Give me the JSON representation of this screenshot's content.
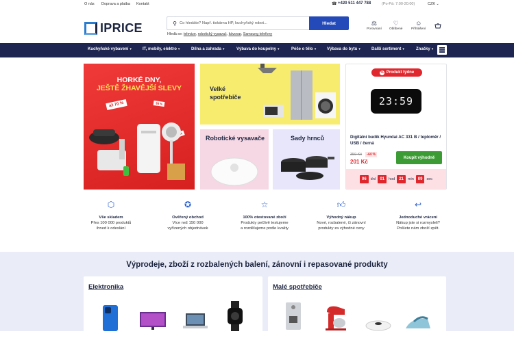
{
  "topbar": {
    "links": [
      "O nás",
      "Doprava a platba",
      "Kontakt"
    ],
    "phone": "+420 511 447 788",
    "hours": "(Po-Pá: 7:00-20:00)",
    "currency": "CZK"
  },
  "header": {
    "logo_text": "IPRICE",
    "search_placeholder": "Co hledáte? Např. tiskárna HP, kuchyňský robot...",
    "search_button": "Hledat",
    "hint_prefix": "Hledá se:",
    "hint_links": [
      "televize",
      "robotický vysavač",
      "kávovar",
      "Samsung telefony"
    ],
    "actions": [
      {
        "icon": "compare-icon",
        "label": "Porovnání"
      },
      {
        "icon": "heart-icon",
        "label": "Oblíbené"
      },
      {
        "icon": "user-icon",
        "label": "Přihlášení"
      },
      {
        "icon": "cart-icon",
        "label": ""
      }
    ]
  },
  "nav": {
    "items": [
      "Kuchyňské vybavení",
      "IT, mobily, elektro",
      "Dílna a zahrada",
      "Výbava do koupelny",
      "Péče o tělo",
      "Výbava do bytu",
      "Další sortiment",
      "Značky"
    ]
  },
  "banners": {
    "hot_line1": "HORKÉ DNY,",
    "hot_line2": "JEŠTĚ ŽHAVĚJŠÍ SLEVY",
    "hot_badges": [
      "až 70 %",
      "38 %",
      "43 %"
    ],
    "large_line1": "Velké",
    "large_line2": "spotřebiče",
    "robot": "Robotické vysavače",
    "pots": "Sady hrnců"
  },
  "product_of_week": {
    "tag": "Produkt týdne",
    "clock_display": "23:59",
    "name": "Digitální budík Hyundai AC 331 B / teploměr / USB / černá",
    "old_price": "359 Kč",
    "discount": "-44 %",
    "price": "201 Kč",
    "buy_button": "Koupit výhodně",
    "countdown": [
      {
        "value": "06",
        "unit": "dní"
      },
      {
        "value": "01",
        "unit": "hod"
      },
      {
        "value": "21",
        "unit": "min"
      },
      {
        "value": "09",
        "unit": "sec"
      }
    ]
  },
  "features": [
    {
      "icon": "box-icon",
      "title": "Vše skladem",
      "line1": "Přes 100 000 produktů",
      "line2": "ihned k odeslání",
      "line3": ""
    },
    {
      "icon": "badge-icon",
      "title": "Ověřený obchod",
      "line1": "Více než 150 000",
      "line2": "vyřízených objednávek",
      "line3": ""
    },
    {
      "icon": "star-icon",
      "title": "100% otestované zboží",
      "line1": "Produkty pečlivě testujeme",
      "line2": "a rozdělujeme podle kvality",
      "line3": ""
    },
    {
      "icon": "thumbs-up-icon",
      "title": "Výhodný nákup",
      "line1": "Nové, rozbalené, či zánovní",
      "line2": "produkty za výhodné ceny",
      "line3": ""
    },
    {
      "icon": "return-icon",
      "title": "Jednoduché vrácení",
      "line1": "Nákup jste si rozmysleli?",
      "line2": "Pošlete nám zboží zpět.",
      "line3": ""
    }
  ],
  "sale": {
    "heading": "Výprodeje, zboží z rozbalených balení, zánovní i repasované produkty",
    "cards": [
      {
        "title": "Elektronika",
        "items": [
          "phone-icon",
          "tv-icon",
          "laptop-icon",
          "watch-icon"
        ]
      },
      {
        "title": "Malé spotřebiče",
        "items": [
          "coffee-machine-icon",
          "food-mixer-icon",
          "robot-vacuum-icon",
          "iron-icon"
        ]
      }
    ]
  },
  "colors": {
    "nav_bg": "#1d2550",
    "accent_blue": "#2449b9",
    "sale_red": "#e0272d",
    "buy_green": "#3d9b35"
  }
}
